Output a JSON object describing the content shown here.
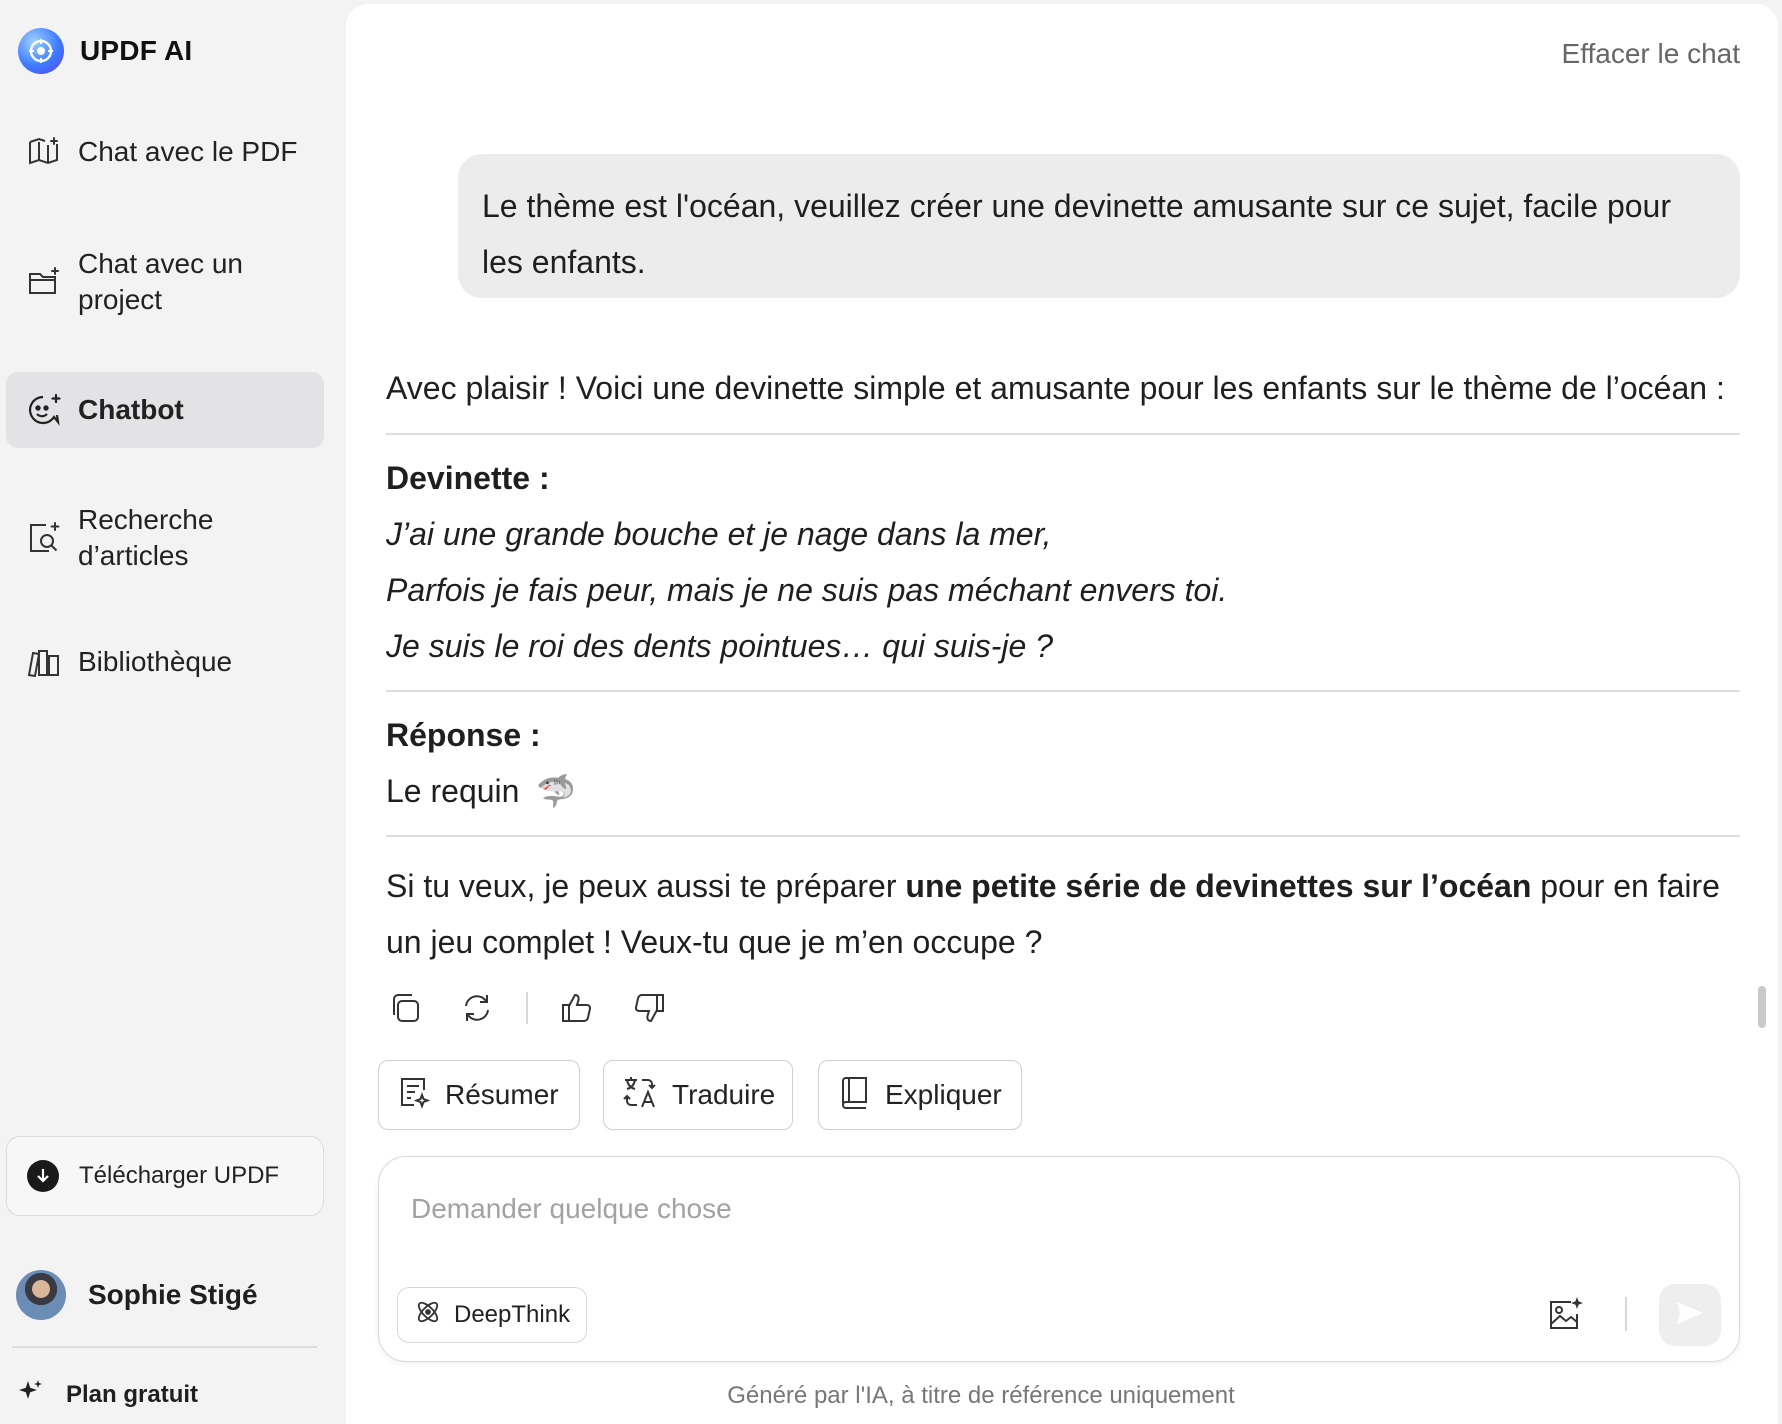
{
  "app": {
    "name": "UPDF AI"
  },
  "sidebar": {
    "items": [
      {
        "label": "Chat avec le PDF",
        "icon": "book-ai-icon"
      },
      {
        "label": "Chat avec un project",
        "icon": "folder-ai-icon"
      },
      {
        "label": "Chatbot",
        "icon": "chatbot-icon",
        "active": true
      },
      {
        "label": "Recherche d’articles",
        "icon": "article-search-icon"
      },
      {
        "label": "Bibliothèque",
        "icon": "library-icon"
      }
    ],
    "download": "Télécharger UPDF",
    "user_name": "Sophie Stigé",
    "plan": "Plan gratuit"
  },
  "header": {
    "clear_chat": "Effacer le chat"
  },
  "conversation": {
    "user_message": "Le thème est l'océan, veuillez créer une devinette amusante sur ce sujet, facile pour les enfants.",
    "intro": "Avec plaisir ! Voici une devinette simple et amusante pour les enfants sur le thème de l’océan :",
    "riddle_title": "Devinette :",
    "riddle_lines": [
      "J’ai une grande bouche et je nage dans la mer,",
      "Parfois je fais peur, mais je ne suis pas méchant envers toi.",
      "Je suis le roi des dents pointues… qui suis-je ?"
    ],
    "answer_title": "Réponse :",
    "answer_text": "Le requin",
    "answer_emoji": "🦈",
    "followup_before": "Si tu veux, je peux aussi te préparer ",
    "followup_bold": "une petite série de devinettes sur l’océan",
    "followup_after": " pour en faire un jeu complet ! Veux-tu que je m’en occupe ?"
  },
  "quick_actions": [
    {
      "label": "Résumer",
      "icon": "summarize-icon"
    },
    {
      "label": "Traduire",
      "icon": "translate-icon"
    },
    {
      "label": "Expliquer",
      "icon": "book-icon"
    }
  ],
  "composer": {
    "placeholder": "Demander quelque chose",
    "deepthink": "DeepThink"
  },
  "footer_note": "Généré par l'IA, à titre de référence uniquement"
}
